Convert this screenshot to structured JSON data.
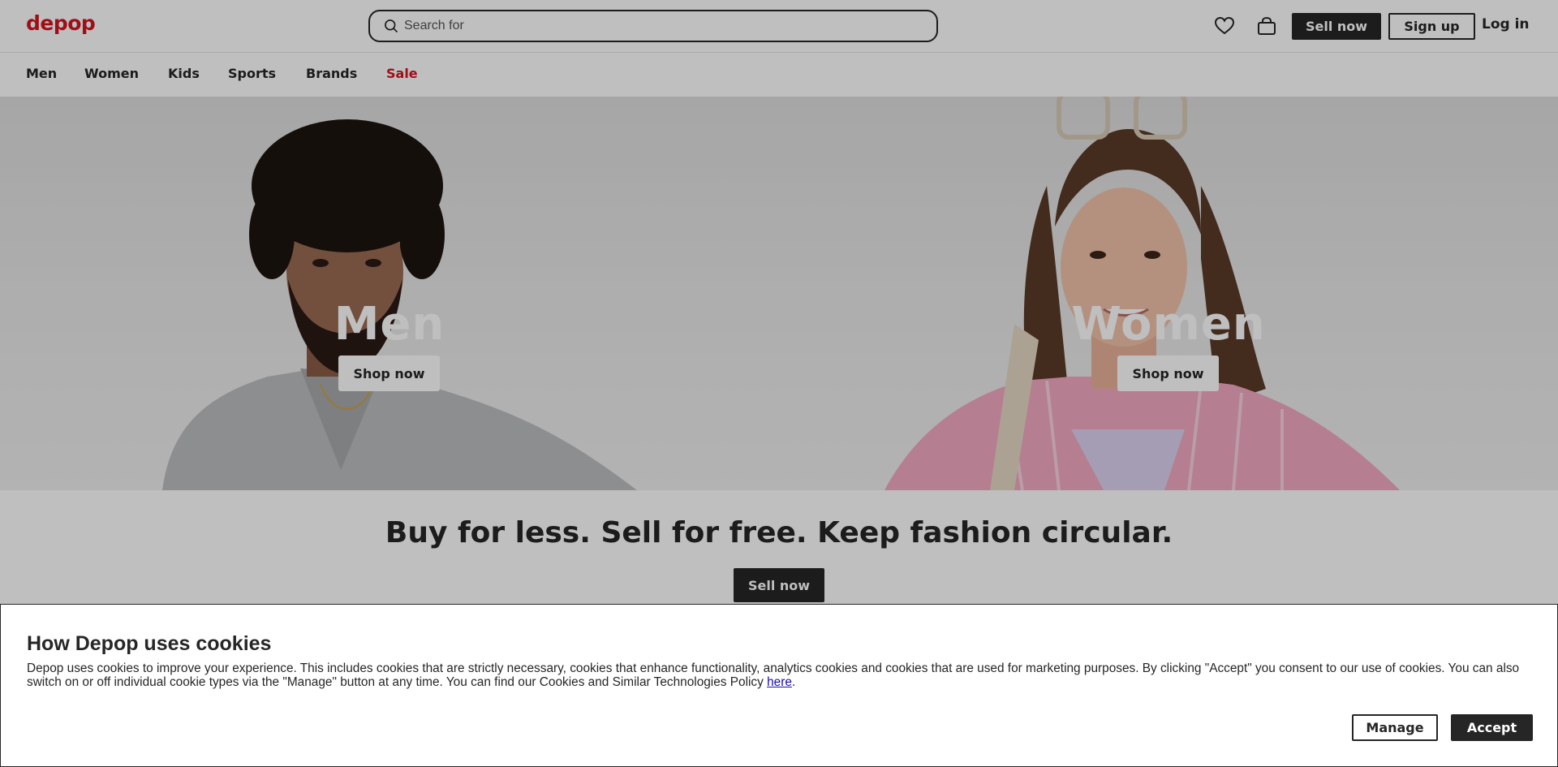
{
  "header": {
    "logo": "depop",
    "search_placeholder": "Search for",
    "sell_now": "Sell now",
    "sign_up": "Sign up",
    "log_in": "Log in"
  },
  "nav": {
    "items": [
      "Men",
      "Women",
      "Kids",
      "Sports",
      "Brands",
      "Sale"
    ]
  },
  "hero": {
    "left": {
      "title": "Men",
      "button": "Shop now"
    },
    "right": {
      "title": "Women",
      "button": "Shop now"
    }
  },
  "tagline": {
    "text": "Buy for less. Sell for free. Keep fashion circular.",
    "button": "Sell now"
  },
  "cookie": {
    "title": "How Depop uses cookies",
    "body": "Depop uses cookies to improve your experience. This includes cookies that are strictly necessary, cookies that enhance functionality, analytics cookies and cookies that are used for marketing purposes. By clicking \"Accept\" you consent to our use of cookies. You can also switch on or off individual cookie types via the \"Manage\" button at any time. You can find our Cookies and Similar Technologies Policy ",
    "link": "here",
    "link_suffix": ".",
    "manage": "Manage",
    "accept": "Accept"
  },
  "colors": {
    "brand_red": "#d4141f",
    "dark": "#262626",
    "overlay": "rgba(0,0,0,0.25)"
  }
}
